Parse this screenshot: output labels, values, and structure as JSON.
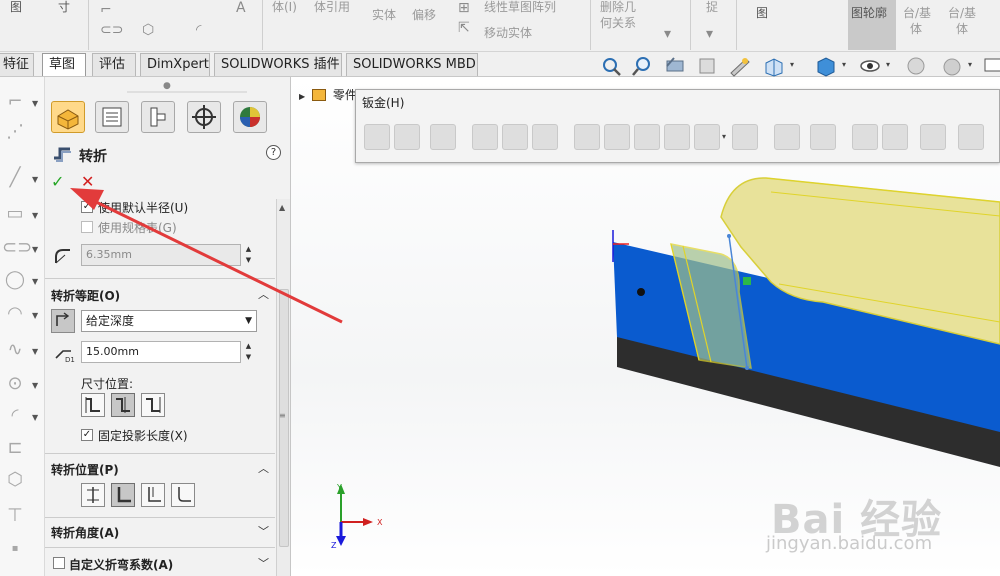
{
  "ribbon": {
    "items": [
      {
        "label": "图",
        "dim": false
      },
      {
        "label": "寸",
        "dim": false
      },
      {
        "label": "体(I)",
        "dim": true
      },
      {
        "label": "体引用",
        "dim": true
      },
      {
        "label": "实体",
        "dim": true
      },
      {
        "label": "偏移",
        "dim": true
      },
      {
        "label": "线性草图阵列",
        "dim": true
      },
      {
        "label": "移动实体",
        "dim": true
      },
      {
        "label": "删除几",
        "dim": true
      },
      {
        "label": "何关系",
        "dim": true
      },
      {
        "label": "捉",
        "dim": true
      },
      {
        "label": "图",
        "dim": false
      },
      {
        "label": "图轮廓",
        "dim": false
      },
      {
        "label": "台/基",
        "dim": true
      },
      {
        "label": "体",
        "dim": true
      },
      {
        "label": "台/基",
        "dim": true
      },
      {
        "label": "体",
        "dim": true
      }
    ]
  },
  "tabs": [
    {
      "label": "特征",
      "active": false
    },
    {
      "label": "草图",
      "active": true
    },
    {
      "label": "评估",
      "active": false
    },
    {
      "label": "DimXpert",
      "active": false
    },
    {
      "label": "SOLIDWORKS 插件",
      "active": false
    },
    {
      "label": "SOLIDWORKS MBD",
      "active": false
    }
  ],
  "property_manager": {
    "title": "转折",
    "help_glyph": "?",
    "ok_glyph": "✓",
    "cancel_glyph": "✕",
    "use_default_radius": {
      "label": "使用默认半径(U)",
      "checked": true
    },
    "use_gauge_table": {
      "label": "使用规格表(G)",
      "checked": false
    },
    "radius_value": "6.35mm",
    "offset_section": {
      "title": "转折等距(O)",
      "end_condition": "给定深度",
      "distance_value": "15.00mm",
      "dimension_position_label": "尺寸位置:",
      "fix_projected_length": {
        "label": "固定投影长度(X)",
        "checked": true
      }
    },
    "position_section": {
      "title": "转折位置(P)"
    },
    "angle_section": {
      "title": "转折角度(A)"
    },
    "custom_bend_allowance": {
      "label": "自定义折弯系数(A)",
      "checked": false
    }
  },
  "graphics": {
    "tree_item": "零件",
    "floating_toolbar_title": "钣金(H)",
    "triad_labels": {
      "x": "X",
      "y": "Y",
      "z": "Z"
    }
  },
  "watermark": {
    "main": "Bai 经验",
    "sub": "jingyan.baidu.com"
  },
  "colors": {
    "part_blue": "#0a5bcf",
    "part_side": "#2d2d2d",
    "highlight_yellow": "#e8e29a",
    "annotation_red": "#e23b3b",
    "ok_green": "#26a626",
    "cancel_red": "#d21f1f"
  }
}
